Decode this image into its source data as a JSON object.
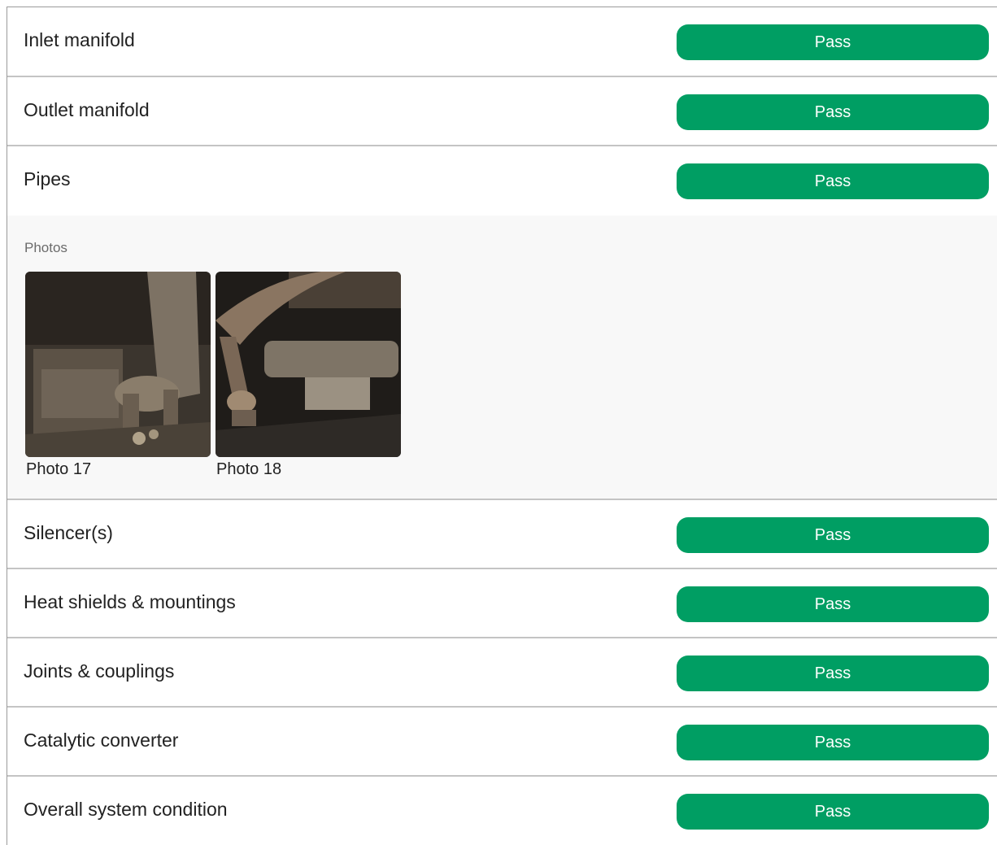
{
  "checklist": {
    "items_before_photos": [
      {
        "label": "Inlet manifold",
        "status": "Pass"
      },
      {
        "label": "Outlet manifold",
        "status": "Pass"
      },
      {
        "label": "Pipes",
        "status": "Pass"
      }
    ],
    "photos": {
      "title": "Photos",
      "items": [
        {
          "caption": "Photo 17"
        },
        {
          "caption": "Photo 18"
        }
      ]
    },
    "items_after_photos": [
      {
        "label": "Silencer(s)",
        "status": "Pass"
      },
      {
        "label": "Heat shields & mountings",
        "status": "Pass"
      },
      {
        "label": "Joints & couplings",
        "status": "Pass"
      },
      {
        "label": "Catalytic converter",
        "status": "Pass"
      },
      {
        "label": "Overall system condition",
        "status": "Pass"
      }
    ]
  },
  "colors": {
    "pass": "#009e63",
    "divider": "#c4c4c4",
    "photos_bg": "#f8f8f8"
  }
}
